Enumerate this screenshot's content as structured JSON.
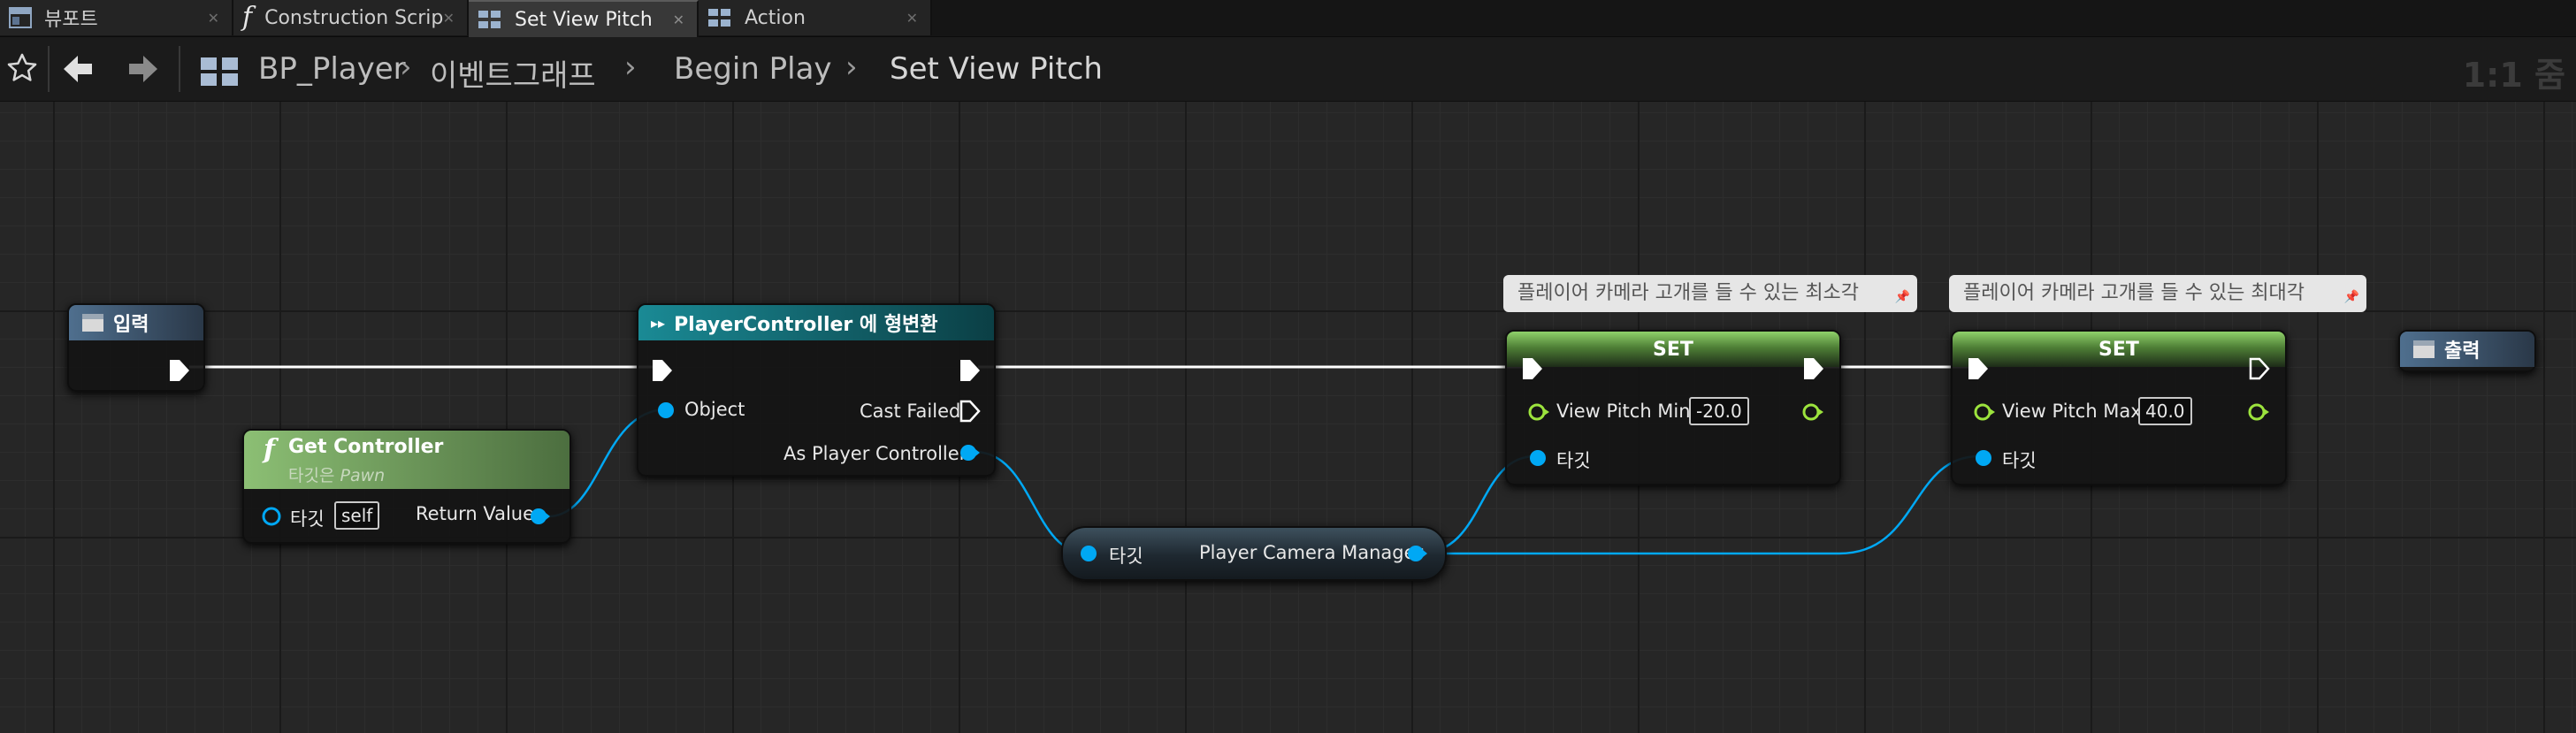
{
  "tabs": [
    {
      "label": "뷰포트",
      "icon": "viewport-icon",
      "active": false
    },
    {
      "label": "Construction Scrip",
      "icon": "function-icon",
      "active": false
    },
    {
      "label": "Set View Pitch",
      "icon": "graph-icon",
      "active": true
    },
    {
      "label": "Action",
      "icon": "graph-icon",
      "active": false
    }
  ],
  "breadcrumb": {
    "items": [
      "BP_Player",
      "이벤트그래프",
      "Begin Play",
      "Set View Pitch"
    ],
    "zoom": "1:1 줌"
  },
  "nodes": {
    "input": {
      "title": "입력"
    },
    "output": {
      "title": "출력"
    },
    "cast": {
      "title": "PlayerController 에 형변환",
      "object_label": "Object",
      "cast_failed_label": "Cast Failed",
      "as_label": "As Player Controller"
    },
    "get_controller": {
      "title": "Get Controller",
      "subtitle_prefix": "타깃은 ",
      "subtitle_target": "Pawn",
      "target_label": "타깃",
      "target_value": "self",
      "return_label": "Return Value"
    },
    "camera_manager": {
      "target_label": "타깃",
      "output_label": "Player Camera Manager"
    },
    "set_min": {
      "comment": "플레이어 카메라 고개를 들 수 있는 최소각",
      "title": "SET",
      "var_label": "View Pitch Min",
      "var_value": "-20.0",
      "target_label": "타깃"
    },
    "set_max": {
      "comment": "플레이어 카메라 고개를 들 수  있는 최대각",
      "title": "SET",
      "var_label": "View Pitch Max",
      "var_value": "40.0",
      "target_label": "타깃"
    }
  },
  "colors": {
    "exec": "#ffffff",
    "object_pin": "#00a8f4",
    "float_pin": "#9ce33d",
    "cast_header": "#0f6e78",
    "function_header": "#6f9a5c",
    "pure_header": "#3b4f5c",
    "set_header": "#6ca24c",
    "event_header": "#4a6a88"
  }
}
